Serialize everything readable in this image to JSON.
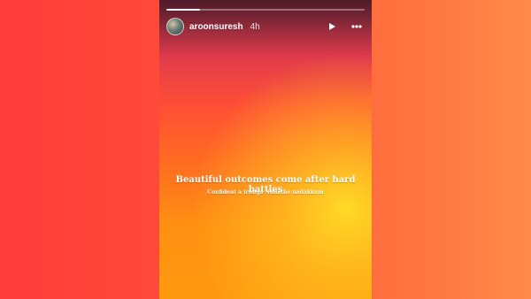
{
  "story": {
    "progress_fraction": 0.17,
    "header": {
      "username": "aroonsuresh",
      "time_ago": "4h",
      "icons": {
        "avatar": "profile-photo",
        "play": "play-icon",
        "more": "more-icon"
      }
    },
    "caption": {
      "headline": "Beautiful outcomes come after hard battles",
      "subline": "Confident a irunga Nallathe nadakkum"
    }
  }
}
